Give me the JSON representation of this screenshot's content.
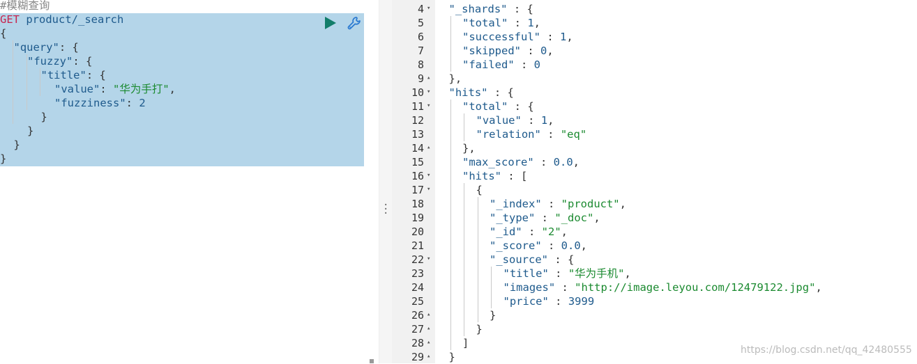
{
  "request": {
    "comment": "#模糊查询",
    "method": "GET",
    "path": "product/_search",
    "body_lines": [
      {
        "indent": 0,
        "tokens": [
          [
            "punc",
            "{"
          ]
        ]
      },
      {
        "indent": 1,
        "tokens": [
          [
            "key",
            "\"query\""
          ],
          [
            "punc",
            ": {"
          ]
        ]
      },
      {
        "indent": 2,
        "tokens": [
          [
            "key",
            "\"fuzzy\""
          ],
          [
            "punc",
            ": {"
          ]
        ]
      },
      {
        "indent": 3,
        "tokens": [
          [
            "key",
            "\"title\""
          ],
          [
            "punc",
            ": {"
          ]
        ]
      },
      {
        "indent": 4,
        "tokens": [
          [
            "key",
            "\"value\""
          ],
          [
            "punc",
            ": "
          ],
          [
            "str",
            "\"华为手打\""
          ],
          [
            "punc",
            ","
          ]
        ]
      },
      {
        "indent": 4,
        "tokens": [
          [
            "key",
            "\"fuzziness\""
          ],
          [
            "punc",
            ": "
          ],
          [
            "num",
            "2"
          ]
        ]
      },
      {
        "indent": 3,
        "tokens": [
          [
            "punc",
            "}"
          ]
        ]
      },
      {
        "indent": 2,
        "tokens": [
          [
            "punc",
            "}"
          ]
        ]
      },
      {
        "indent": 1,
        "tokens": [
          [
            "punc",
            "}"
          ]
        ]
      },
      {
        "indent": 0,
        "tokens": [
          [
            "punc",
            "}"
          ]
        ]
      }
    ]
  },
  "response": {
    "lines": [
      {
        "n": "4",
        "fold": "down",
        "indent": 1,
        "tokens": [
          [
            "key",
            "\"_shards\""
          ],
          [
            "punc",
            " : {"
          ]
        ]
      },
      {
        "n": "5",
        "indent": 2,
        "tokens": [
          [
            "key",
            "\"total\""
          ],
          [
            "punc",
            " : "
          ],
          [
            "num",
            "1"
          ],
          [
            "punc",
            ","
          ]
        ]
      },
      {
        "n": "6",
        "indent": 2,
        "tokens": [
          [
            "key",
            "\"successful\""
          ],
          [
            "punc",
            " : "
          ],
          [
            "num",
            "1"
          ],
          [
            "punc",
            ","
          ]
        ]
      },
      {
        "n": "7",
        "indent": 2,
        "tokens": [
          [
            "key",
            "\"skipped\""
          ],
          [
            "punc",
            " : "
          ],
          [
            "num",
            "0"
          ],
          [
            "punc",
            ","
          ]
        ]
      },
      {
        "n": "8",
        "indent": 2,
        "tokens": [
          [
            "key",
            "\"failed\""
          ],
          [
            "punc",
            " : "
          ],
          [
            "num",
            "0"
          ]
        ]
      },
      {
        "n": "9",
        "fold": "up",
        "indent": 1,
        "tokens": [
          [
            "punc",
            "},"
          ]
        ]
      },
      {
        "n": "10",
        "fold": "down",
        "indent": 1,
        "tokens": [
          [
            "key",
            "\"hits\""
          ],
          [
            "punc",
            " : {"
          ]
        ]
      },
      {
        "n": "11",
        "fold": "down",
        "indent": 2,
        "tokens": [
          [
            "key",
            "\"total\""
          ],
          [
            "punc",
            " : {"
          ]
        ]
      },
      {
        "n": "12",
        "indent": 3,
        "tokens": [
          [
            "key",
            "\"value\""
          ],
          [
            "punc",
            " : "
          ],
          [
            "num",
            "1"
          ],
          [
            "punc",
            ","
          ]
        ]
      },
      {
        "n": "13",
        "indent": 3,
        "tokens": [
          [
            "key",
            "\"relation\""
          ],
          [
            "punc",
            " : "
          ],
          [
            "str",
            "\"eq\""
          ]
        ]
      },
      {
        "n": "14",
        "fold": "up",
        "indent": 2,
        "tokens": [
          [
            "punc",
            "},"
          ]
        ]
      },
      {
        "n": "15",
        "indent": 2,
        "tokens": [
          [
            "key",
            "\"max_score\""
          ],
          [
            "punc",
            " : "
          ],
          [
            "num",
            "0.0"
          ],
          [
            "punc",
            ","
          ]
        ]
      },
      {
        "n": "16",
        "fold": "down",
        "indent": 2,
        "tokens": [
          [
            "key",
            "\"hits\""
          ],
          [
            "punc",
            " : ["
          ]
        ]
      },
      {
        "n": "17",
        "fold": "down",
        "indent": 3,
        "tokens": [
          [
            "punc",
            "{"
          ]
        ]
      },
      {
        "n": "18",
        "indent": 4,
        "tokens": [
          [
            "key",
            "\"_index\""
          ],
          [
            "punc",
            " : "
          ],
          [
            "str",
            "\"product\""
          ],
          [
            "punc",
            ","
          ]
        ]
      },
      {
        "n": "19",
        "indent": 4,
        "tokens": [
          [
            "key",
            "\"_type\""
          ],
          [
            "punc",
            " : "
          ],
          [
            "str",
            "\"_doc\""
          ],
          [
            "punc",
            ","
          ]
        ]
      },
      {
        "n": "20",
        "indent": 4,
        "tokens": [
          [
            "key",
            "\"_id\""
          ],
          [
            "punc",
            " : "
          ],
          [
            "str",
            "\"2\""
          ],
          [
            "punc",
            ","
          ]
        ]
      },
      {
        "n": "21",
        "indent": 4,
        "tokens": [
          [
            "key",
            "\"_score\""
          ],
          [
            "punc",
            " : "
          ],
          [
            "num",
            "0.0"
          ],
          [
            "punc",
            ","
          ]
        ]
      },
      {
        "n": "22",
        "fold": "down",
        "indent": 4,
        "tokens": [
          [
            "key",
            "\"_source\""
          ],
          [
            "punc",
            " : {"
          ]
        ]
      },
      {
        "n": "23",
        "indent": 5,
        "tokens": [
          [
            "key",
            "\"title\""
          ],
          [
            "punc",
            " : "
          ],
          [
            "str",
            "\"华为手机\""
          ],
          [
            "punc",
            ","
          ]
        ]
      },
      {
        "n": "24",
        "indent": 5,
        "tokens": [
          [
            "key",
            "\"images\""
          ],
          [
            "punc",
            " : "
          ],
          [
            "str",
            "\"http://image.leyou.com/12479122.jpg\""
          ],
          [
            "punc",
            ","
          ]
        ]
      },
      {
        "n": "25",
        "indent": 5,
        "tokens": [
          [
            "key",
            "\"price\""
          ],
          [
            "punc",
            " : "
          ],
          [
            "num",
            "3999"
          ]
        ]
      },
      {
        "n": "26",
        "fold": "up",
        "indent": 4,
        "tokens": [
          [
            "punc",
            "}"
          ]
        ]
      },
      {
        "n": "27",
        "fold": "up",
        "indent": 3,
        "tokens": [
          [
            "punc",
            "}"
          ]
        ]
      },
      {
        "n": "28",
        "fold": "up",
        "indent": 2,
        "tokens": [
          [
            "punc",
            "]"
          ]
        ]
      },
      {
        "n": "29",
        "fold": "up",
        "indent": 1,
        "tokens": [
          [
            "punc",
            "}"
          ]
        ]
      }
    ]
  },
  "watermark": "https://blog.csdn.net/qq_42480555",
  "colors": {
    "selection": "#b4d5e9",
    "run": "#127d6a",
    "wrench": "#2c7bd1"
  },
  "icons": {
    "run": "play-icon",
    "settings": "wrench-icon",
    "resize": "vertical-dots-icon"
  }
}
